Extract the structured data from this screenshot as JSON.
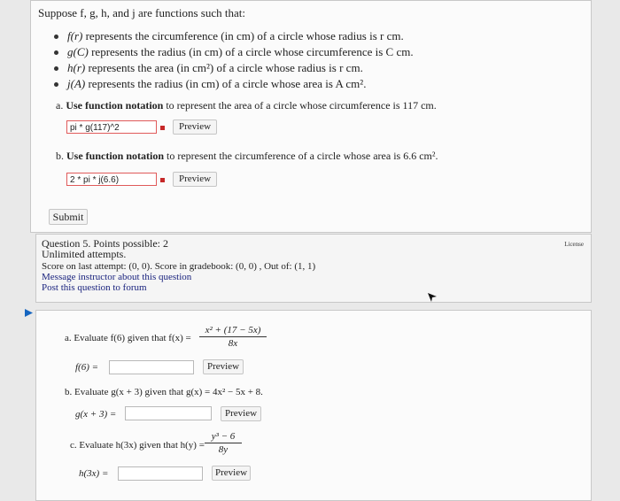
{
  "question4": {
    "intro": "Suppose f, g, h, and j are functions such that:",
    "bullets": [
      {
        "fn": "f(r)",
        "text": "represents the circumference (in cm) of a circle whose radius is r cm."
      },
      {
        "fn": "g(C)",
        "text": "represents the radius (in cm) of a circle whose circumference is C cm."
      },
      {
        "fn": "h(r)",
        "text": "represents the area (in cm²) of a circle whose radius is r cm."
      },
      {
        "fn": "j(A)",
        "text": "represents the radius (in cm) of a circle whose area is A cm²."
      }
    ],
    "part_a": {
      "prefix": "a.",
      "bold": "Use function notation",
      "rest": "to represent the area of a circle whose circumference is 117 cm.",
      "answer": "pi * g(117)^2",
      "preview_label": "Preview"
    },
    "part_b": {
      "prefix": "b.",
      "bold": "Use function notation",
      "rest": "to represent the circumference of a circle whose area is 6.6 cm².",
      "answer": "2 * pi * j(6.6)",
      "preview_label": "Preview"
    },
    "submit_label": "Submit"
  },
  "question5_info": {
    "title": "Question 5. Points possible: 2",
    "attempts": "Unlimited attempts.",
    "score": "Score on last attempt: (0, 0). Score in gradebook: (0, 0) , Out of: (1, 1)",
    "message_link": "Message instructor about this question",
    "post_link": "Post this question to forum",
    "license": "License"
  },
  "question5": {
    "part_a": {
      "label": "a. Evaluate f(6) given that f(x) =",
      "numerator": "x² + (17 − 5x)",
      "denominator": "8x",
      "input_label": "f(6) =",
      "input_value": "",
      "preview_label": "Preview"
    },
    "part_b": {
      "label": "b. Evaluate g(x + 3) given that g(x) = 4x² − 5x + 8.",
      "input_label": "g(x + 3) =",
      "input_value": "",
      "preview_label": "Preview"
    },
    "part_c": {
      "label": "c. Evaluate h(3x) given that h(y) =",
      "numerator": "y³ − 6",
      "denominator": "8y",
      "input_label": "h(3x) =",
      "input_value": "",
      "preview_label": "Preview"
    }
  },
  "colors": {
    "error": "#c62828",
    "link": "#1a237e",
    "arrow": "#1565c0"
  }
}
